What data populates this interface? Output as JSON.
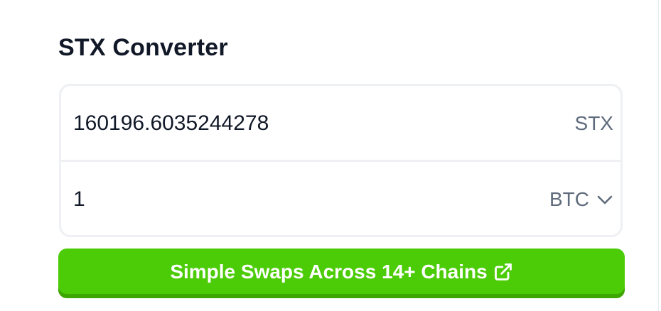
{
  "converter": {
    "title": "STX Converter",
    "from": {
      "amount": "160196.6035244278",
      "currency": "STX"
    },
    "to": {
      "amount": "1",
      "currency": "BTC"
    }
  },
  "swap_button": {
    "label": "Simple Swaps Across 14+ Chains",
    "icon": "external-link-icon",
    "color": "#4ccc07"
  },
  "icons": {
    "currency_dropdown": "chevron-down-icon"
  }
}
